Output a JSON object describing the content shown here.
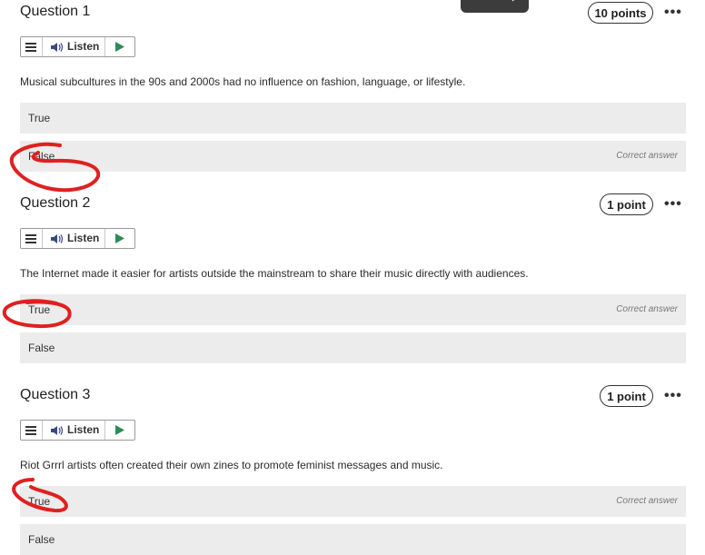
{
  "toolbar_labels": {
    "listen": "Listen"
  },
  "questions": [
    {
      "title": "Question 1",
      "points": "10 points",
      "text": "Musical subcultures in the 90s and 2000s had no influence on fashion, language, or lifestyle.",
      "options": [
        {
          "label": "True",
          "note": ""
        },
        {
          "label": "False",
          "note": "Correct answer"
        }
      ]
    },
    {
      "title": "Question 2",
      "points": "1 point",
      "text": "The Internet made it easier for artists outside the mainstream to share their music directly with audiences.",
      "options": [
        {
          "label": "True",
          "note": "Correct answer"
        },
        {
          "label": "False",
          "note": ""
        }
      ]
    },
    {
      "title": "Question 3",
      "points": "1 point",
      "text": "Riot Grrrl artists often created their own zines to promote feminist messages and music.",
      "options": [
        {
          "label": "True",
          "note": "Correct answer"
        },
        {
          "label": "False",
          "note": ""
        }
      ]
    }
  ],
  "icons": {
    "menu": "hamburger-menu-icon",
    "speaker": "speaker-icon",
    "play": "play-icon",
    "more": "more-options-icon"
  },
  "colors": {
    "play": "#2e8b57",
    "annotation": "#e0201f",
    "option_bg": "#ececec"
  }
}
